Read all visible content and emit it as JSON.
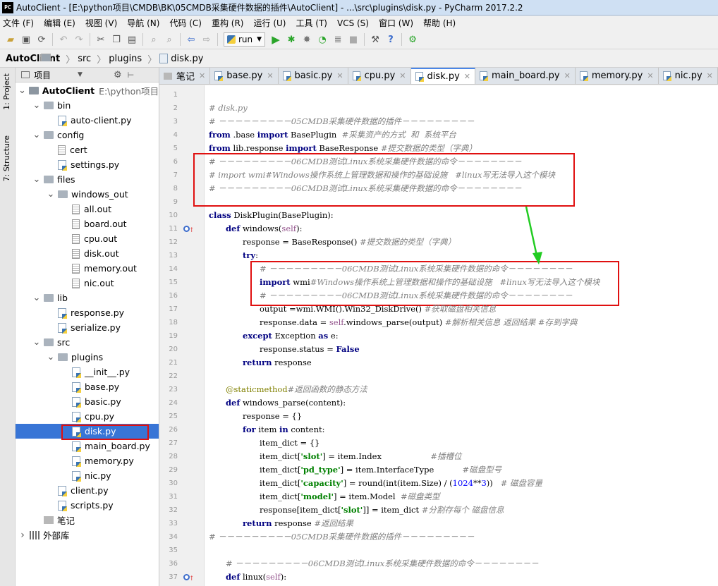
{
  "window": {
    "title": "AutoClient - [E:\\python项目\\CMDB\\BK\\05CMDB采集硬件数据的插件\\AutoClient] - ...\\src\\plugins\\disk.py - PyCharm 2017.2.2",
    "app_icon_text": "PC"
  },
  "menu": [
    "文件 (F)",
    "编辑 (E)",
    "视图 (V)",
    "导航 (N)",
    "代码 (C)",
    "重构 (R)",
    "运行 (U)",
    "工具 (T)",
    "VCS (S)",
    "窗口 (W)",
    "帮助 (H)"
  ],
  "toolbar": {
    "run_config": "run"
  },
  "breadcrumb": [
    "AutoClient",
    "src",
    "plugins",
    "disk.py"
  ],
  "side_tabs": [
    "1: Project",
    "7: Structure"
  ],
  "project_panel": {
    "title": "项目",
    "tree": [
      {
        "label": "AutoClient",
        "note": "E:\\python项目\\C",
        "kind": "root",
        "depth": 0,
        "arrow": "v"
      },
      {
        "label": "bin",
        "kind": "folder",
        "depth": 1,
        "arrow": "v"
      },
      {
        "label": "auto-client.py",
        "kind": "py",
        "depth": 2,
        "arrow": ""
      },
      {
        "label": "config",
        "kind": "folder",
        "depth": 1,
        "arrow": "v"
      },
      {
        "label": "cert",
        "kind": "file",
        "depth": 2,
        "arrow": ""
      },
      {
        "label": "settings.py",
        "kind": "py",
        "depth": 2,
        "arrow": ""
      },
      {
        "label": "files",
        "kind": "folder",
        "depth": 1,
        "arrow": "v"
      },
      {
        "label": "windows_out",
        "kind": "folder",
        "depth": 2,
        "arrow": "v"
      },
      {
        "label": "all.out",
        "kind": "file",
        "depth": 3,
        "arrow": ""
      },
      {
        "label": "board.out",
        "kind": "file",
        "depth": 3,
        "arrow": ""
      },
      {
        "label": "cpu.out",
        "kind": "file",
        "depth": 3,
        "arrow": ""
      },
      {
        "label": "disk.out",
        "kind": "file",
        "depth": 3,
        "arrow": ""
      },
      {
        "label": "memory.out",
        "kind": "file",
        "depth": 3,
        "arrow": ""
      },
      {
        "label": "nic.out",
        "kind": "file",
        "depth": 3,
        "arrow": ""
      },
      {
        "label": "lib",
        "kind": "folder",
        "depth": 1,
        "arrow": "v"
      },
      {
        "label": "response.py",
        "kind": "py",
        "depth": 2,
        "arrow": ""
      },
      {
        "label": "serialize.py",
        "kind": "py",
        "depth": 2,
        "arrow": ""
      },
      {
        "label": "src",
        "kind": "folder",
        "depth": 1,
        "arrow": "v"
      },
      {
        "label": "plugins",
        "kind": "folder",
        "depth": 2,
        "arrow": "v"
      },
      {
        "label": "__init__.py",
        "kind": "py",
        "depth": 3,
        "arrow": ""
      },
      {
        "label": "base.py",
        "kind": "py",
        "depth": 3,
        "arrow": ""
      },
      {
        "label": "basic.py",
        "kind": "py",
        "depth": 3,
        "arrow": ""
      },
      {
        "label": "cpu.py",
        "kind": "py",
        "depth": 3,
        "arrow": ""
      },
      {
        "label": "disk.py",
        "kind": "py",
        "depth": 3,
        "arrow": "",
        "selected": true
      },
      {
        "label": "main_board.py",
        "kind": "py",
        "depth": 3,
        "arrow": ""
      },
      {
        "label": "memory.py",
        "kind": "py",
        "depth": 3,
        "arrow": ""
      },
      {
        "label": "nic.py",
        "kind": "py",
        "depth": 3,
        "arrow": ""
      },
      {
        "label": "client.py",
        "kind": "py",
        "depth": 2,
        "arrow": ""
      },
      {
        "label": "scripts.py",
        "kind": "py",
        "depth": 2,
        "arrow": ""
      },
      {
        "label": "笔记",
        "kind": "note",
        "depth": 1,
        "arrow": ""
      },
      {
        "label": "外部库",
        "kind": "lib",
        "depth": 0,
        "arrow": ">"
      }
    ]
  },
  "tabs": [
    {
      "label": "笔记",
      "kind": "note",
      "active": false
    },
    {
      "label": "base.py",
      "kind": "py",
      "active": false
    },
    {
      "label": "basic.py",
      "kind": "py",
      "active": false
    },
    {
      "label": "cpu.py",
      "kind": "py",
      "active": false
    },
    {
      "label": "disk.py",
      "kind": "py",
      "active": true
    },
    {
      "label": "main_board.py",
      "kind": "py",
      "active": false
    },
    {
      "label": "memory.py",
      "kind": "py",
      "active": false
    },
    {
      "label": "nic.py",
      "kind": "py",
      "active": false
    }
  ],
  "code_lines": [
    {
      "n": "1",
      "indent": 0,
      "parts": []
    },
    {
      "n": "2",
      "indent": 0,
      "parts": [
        [
          "cm",
          "# disk.py"
        ]
      ]
    },
    {
      "n": "3",
      "indent": 0,
      "parts": [
        [
          "cm",
          "# －－－－－－－－－05CMDB采集硬件数据的插件－－－－－－－－－"
        ]
      ]
    },
    {
      "n": "4",
      "indent": 0,
      "parts": [
        [
          "kw",
          "from"
        ],
        [
          "",
          " .base "
        ],
        [
          "kw",
          "import"
        ],
        [
          "",
          " BasePlugin  "
        ],
        [
          "cm",
          "#采集资产的方式  和  系统平台"
        ]
      ]
    },
    {
      "n": "5",
      "indent": 0,
      "parts": [
        [
          "kw",
          "from"
        ],
        [
          "",
          " lib.response "
        ],
        [
          "kw",
          "import"
        ],
        [
          "",
          " BaseResponse "
        ],
        [
          "cm",
          "#提交数据的类型（字典）"
        ]
      ]
    },
    {
      "n": "6",
      "indent": 0,
      "parts": [
        [
          "cm",
          "# －－－－－－－－－06CMDB测试Linux系统采集硬件数据的命令－－－－－－－－"
        ]
      ]
    },
    {
      "n": "7",
      "indent": 0,
      "parts": [
        [
          "cm",
          "# import wmi#Windows操作系统上管理数据和操作的基础设施   #linux写无法导入这个模块"
        ]
      ]
    },
    {
      "n": "8",
      "indent": 0,
      "parts": [
        [
          "cm",
          "# －－－－－－－－－06CMDB测试Linux系统采集硬件数据的命令－－－－－－－－"
        ]
      ]
    },
    {
      "n": "9",
      "indent": 0,
      "parts": []
    },
    {
      "n": "10",
      "indent": 0,
      "parts": [
        [
          "kw",
          "class"
        ],
        [
          "",
          " DiskPlugin(BasePlugin):"
        ]
      ]
    },
    {
      "n": "11",
      "indent": 1,
      "marker": true,
      "parts": [
        [
          "kw",
          "def"
        ],
        [
          "",
          " windows("
        ],
        [
          "selfk",
          "self"
        ],
        [
          "",
          "):"
        ]
      ]
    },
    {
      "n": "12",
      "indent": 2,
      "parts": [
        [
          "",
          "response = BaseResponse() "
        ],
        [
          "cm",
          "#提交数据的类型（字典）"
        ]
      ]
    },
    {
      "n": "13",
      "indent": 2,
      "parts": [
        [
          "kw",
          "try"
        ],
        [
          "",
          ":"
        ]
      ]
    },
    {
      "n": "14",
      "indent": 3,
      "parts": [
        [
          "cm",
          "# －－－－－－－－－06CMDB测试Linux系统采集硬件数据的命令－－－－－－－－"
        ]
      ]
    },
    {
      "n": "15",
      "indent": 3,
      "parts": [
        [
          "kw",
          "import"
        ],
        [
          "",
          " wmi"
        ],
        [
          "cm",
          "#Windows操作系统上管理数据和操作的基础设施   #linux写无法导入这个模块"
        ]
      ]
    },
    {
      "n": "16",
      "indent": 3,
      "parts": [
        [
          "cm",
          "# －－－－－－－－－06CMDB测试Linux系统采集硬件数据的命令－－－－－－－－"
        ]
      ]
    },
    {
      "n": "17",
      "indent": 3,
      "parts": [
        [
          "",
          "output =wmi.WMI().Win32_DiskDrive() "
        ],
        [
          "cm",
          "#获取磁盘相关信息"
        ]
      ]
    },
    {
      "n": "18",
      "indent": 3,
      "parts": [
        [
          "",
          "response.data = "
        ],
        [
          "selfk",
          "self"
        ],
        [
          "",
          ".windows_parse(output) "
        ],
        [
          "cm",
          "#解析相关信息 返回结果 #存到字典"
        ]
      ]
    },
    {
      "n": "19",
      "indent": 2,
      "parts": [
        [
          "kw",
          "except"
        ],
        [
          "",
          " Exception "
        ],
        [
          "kw",
          "as"
        ],
        [
          "",
          " e:"
        ]
      ]
    },
    {
      "n": "20",
      "indent": 3,
      "parts": [
        [
          "",
          "response.status = "
        ],
        [
          "kw",
          "False"
        ]
      ]
    },
    {
      "n": "21",
      "indent": 2,
      "parts": [
        [
          "kw",
          "return"
        ],
        [
          "",
          " response"
        ]
      ]
    },
    {
      "n": "22",
      "indent": 0,
      "parts": []
    },
    {
      "n": "23",
      "indent": 1,
      "parts": [
        [
          "deco",
          "@staticmethod"
        ],
        [
          "cm",
          "#返回函数的静态方法"
        ]
      ]
    },
    {
      "n": "24",
      "indent": 1,
      "parts": [
        [
          "kw",
          "def"
        ],
        [
          "",
          " windows_parse(content):"
        ]
      ]
    },
    {
      "n": "25",
      "indent": 2,
      "parts": [
        [
          "",
          "response = {}"
        ]
      ]
    },
    {
      "n": "26",
      "indent": 2,
      "parts": [
        [
          "kw",
          "for"
        ],
        [
          "",
          " item "
        ],
        [
          "kw",
          "in"
        ],
        [
          "",
          " content:"
        ]
      ]
    },
    {
      "n": "27",
      "indent": 3,
      "parts": [
        [
          "",
          "item_dict = {}"
        ]
      ]
    },
    {
      "n": "28",
      "indent": 3,
      "parts": [
        [
          "",
          "item_dict["
        ],
        [
          "str",
          "'slot'"
        ],
        [
          "",
          "] = item.Index                   "
        ],
        [
          "cm",
          "#插槽位"
        ]
      ]
    },
    {
      "n": "29",
      "indent": 3,
      "parts": [
        [
          "",
          "item_dict["
        ],
        [
          "str",
          "'pd_type'"
        ],
        [
          "",
          "] = item.InterfaceType           "
        ],
        [
          "cm",
          "#磁盘型号"
        ]
      ]
    },
    {
      "n": "30",
      "indent": 3,
      "parts": [
        [
          "",
          "item_dict["
        ],
        [
          "str",
          "'capacity'"
        ],
        [
          "",
          "] = round(int(item.Size) / ("
        ],
        [
          "num",
          "1024"
        ],
        [
          "",
          "**"
        ],
        [
          "num",
          "3"
        ],
        [
          "",
          "))   "
        ],
        [
          "cm",
          "# 磁盘容量"
        ]
      ]
    },
    {
      "n": "31",
      "indent": 3,
      "parts": [
        [
          "",
          "item_dict["
        ],
        [
          "str",
          "'model'"
        ],
        [
          "",
          "] = item.Model  "
        ],
        [
          "cm",
          "#磁盘类型"
        ]
      ]
    },
    {
      "n": "32",
      "indent": 3,
      "parts": [
        [
          "",
          "response[item_dict["
        ],
        [
          "str",
          "'slot'"
        ],
        [
          "",
          "]] = item_dict "
        ],
        [
          "cm",
          "#分割存每个 磁盘信息"
        ]
      ]
    },
    {
      "n": "33",
      "indent": 2,
      "parts": [
        [
          "kw",
          "return"
        ],
        [
          "",
          " response "
        ],
        [
          "cm",
          "#返回结果"
        ]
      ]
    },
    {
      "n": "34",
      "indent": 0,
      "parts": [
        [
          "cm",
          "# －－－－－－－－－05CMDB采集硬件数据的插件－－－－－－－－－"
        ]
      ]
    },
    {
      "n": "35",
      "indent": 0,
      "parts": []
    },
    {
      "n": "36",
      "indent": 1,
      "parts": [
        [
          "cm",
          "# －－－－－－－－－06CMDB测试Linux系统采集硬件数据的命令－－－－－－－－"
        ]
      ]
    },
    {
      "n": "37",
      "indent": 1,
      "marker": true,
      "parts": [
        [
          "kw",
          "def"
        ],
        [
          "",
          " linux("
        ],
        [
          "selfk",
          "self"
        ],
        [
          "",
          "):"
        ]
      ]
    }
  ],
  "colors": {
    "highlight_box": "#e01010",
    "arrow": "#22cc22",
    "selection": "#3875d6",
    "active_tab_accent": "#4a86e8"
  }
}
